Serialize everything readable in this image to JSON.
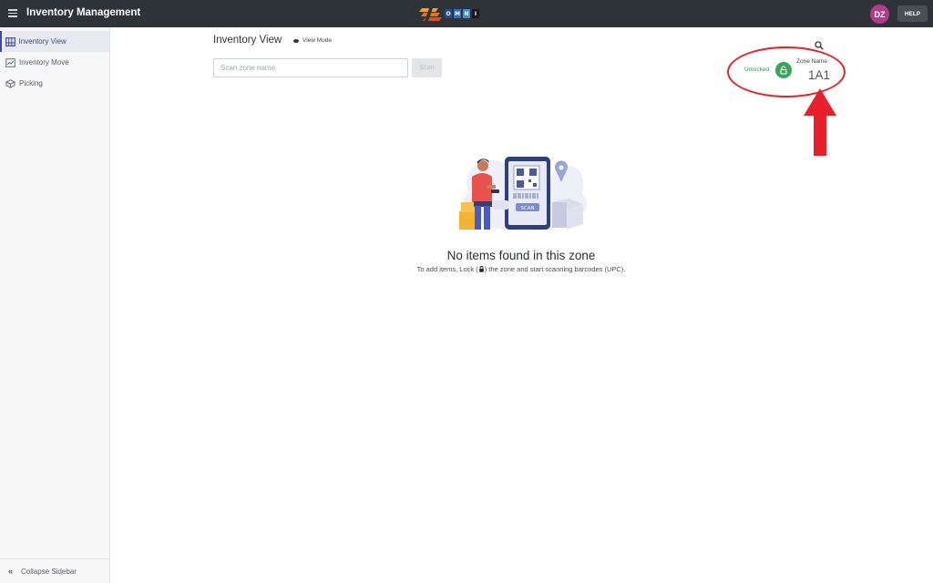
{
  "header": {
    "app_title": "Inventory Management",
    "brand_letters": [
      "O",
      "M",
      "N",
      "I"
    ],
    "brand_letter_colors": [
      "#1e4c8f",
      "#2f6dbf",
      "#3f8ee0",
      "#1a1a1a"
    ],
    "avatar_initials": "DZ",
    "avatar_color": "#b53a8c",
    "help_label": "HELP"
  },
  "sidebar": {
    "items": [
      {
        "label": "Inventory View",
        "icon": "inventory-view-icon",
        "active": true
      },
      {
        "label": "Inventory Move",
        "icon": "inventory-move-icon",
        "active": false
      },
      {
        "label": "Picking",
        "icon": "picking-icon",
        "active": false
      }
    ],
    "collapse_label": "Collapse Sidebar"
  },
  "main": {
    "title": "Inventory View",
    "mode_label": "View Mode",
    "scan_input": {
      "placeholder": "Scan zone name",
      "value": ""
    },
    "scan_button": "Scan",
    "lock_status": "Unlocked",
    "lock_status_color": "#2e9a4a",
    "zone_caption": "Zone Name",
    "zone_value": "1A1",
    "illustration_badge": "SCAN",
    "empty_title": "No items found in this zone",
    "empty_sub_before": "To add items, Lock (",
    "empty_sub_after": ") the zone and start scanning barcodes (UPC)."
  },
  "annotation": {
    "color": "#e8202a"
  }
}
